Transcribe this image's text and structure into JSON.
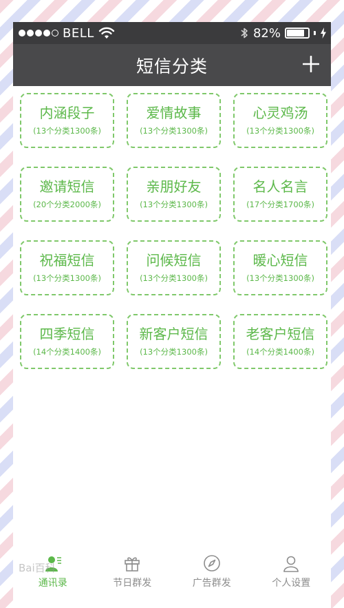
{
  "status_bar": {
    "carrier": "BELL",
    "battery": "82%",
    "battery_level": 0.82
  },
  "nav": {
    "title": "短信分类",
    "add_label": "+"
  },
  "categories": [
    {
      "title": "内涵段子",
      "sub": "(13个分类1300条)"
    },
    {
      "title": "爱情故事",
      "sub": "(13个分类1300条)"
    },
    {
      "title": "心灵鸡汤",
      "sub": "(13个分类1300条)"
    },
    {
      "title": "邀请短信",
      "sub": "(20个分类2000条)"
    },
    {
      "title": "亲朋好友",
      "sub": "(13个分类1300条)"
    },
    {
      "title": "名人名言",
      "sub": "(17个分类1700条)"
    },
    {
      "title": "祝福短信",
      "sub": "(13个分类1300条)"
    },
    {
      "title": "问候短信",
      "sub": "(13个分类1300条)"
    },
    {
      "title": "暖心短信",
      "sub": "(13个分类1300条)"
    },
    {
      "title": "四季短信",
      "sub": "(14个分类1400条)"
    },
    {
      "title": "新客户短信",
      "sub": "(13个分类1300条)"
    },
    {
      "title": "老客户短信",
      "sub": "(14个分类1400条)"
    }
  ],
  "tabs": [
    {
      "label": "通讯录",
      "icon": "contacts-icon",
      "active": true
    },
    {
      "label": "节日群发",
      "icon": "gift-icon",
      "active": false
    },
    {
      "label": "广告群发",
      "icon": "compass-icon",
      "active": false
    },
    {
      "label": "个人设置",
      "icon": "person-icon",
      "active": false
    }
  ],
  "watermark": "Bai百科",
  "colors": {
    "accent": "#5cb84a",
    "card_border": "#7fc86a",
    "nav_bg": "#49494b",
    "status_bg": "#3b3b3d",
    "tab_inactive": "#8d8d8d"
  }
}
